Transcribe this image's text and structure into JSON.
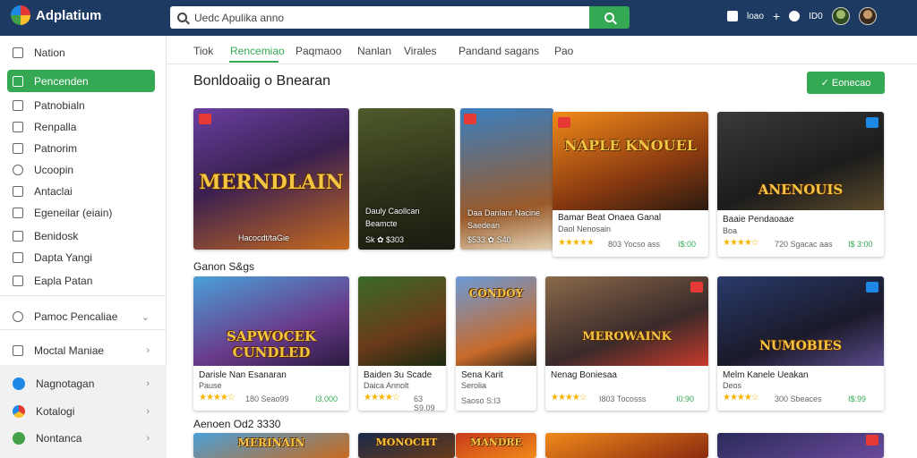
{
  "app": {
    "title": "Adplatium"
  },
  "search": {
    "placeholder": "Uedc Apulika anno",
    "value": "Uedc Apulika anno"
  },
  "topbar": {
    "label_1": "loao",
    "label_2": "ID0"
  },
  "sidebar": {
    "items": [
      {
        "label": "Nation"
      },
      {
        "label": "Pencenden"
      },
      {
        "label": "Patnobialn"
      },
      {
        "label": "Renpalla"
      },
      {
        "label": "Patnorim"
      },
      {
        "label": "Ucoopin"
      },
      {
        "label": "Antaclai"
      },
      {
        "label": "Egeneilar (eiain)"
      },
      {
        "label": "Benidosk"
      },
      {
        "label": "Dapta Yangi"
      },
      {
        "label": "Eapla Patan"
      },
      {
        "label": "Pamoc Pencaliae"
      },
      {
        "label": "Moctal Maniae"
      },
      {
        "label": "Nagnotagan"
      },
      {
        "label": "Kotalogi"
      },
      {
        "label": "Nontanca"
      }
    ]
  },
  "tabs": [
    "Tiok",
    "Rencemiao",
    "Paqmaoo",
    "Nanlan",
    "Virales",
    "Pandand sagans",
    "Pao"
  ],
  "section": {
    "title": "Bonldoaiig  o  Bnearan",
    "button": "✓ Eonecao"
  },
  "row1": [
    {
      "art_title": "MERNDLAIN",
      "art_sub": "Hacocdt/taGie",
      "title": "",
      "sub": "",
      "rating": "",
      "price": ""
    },
    {
      "art_title": "",
      "art_sub": "Dauly Caollcan",
      "art_sub2": "Beamcte",
      "art_sub3": "Sk ✿ $303",
      "title": "",
      "sub": ""
    },
    {
      "art_title": "",
      "art_sub": "Daa Danlanr Nacine",
      "art_sub2": "Saedean",
      "art_sub3": "$533 ✿ S40",
      "title": "",
      "sub": ""
    },
    {
      "art_title": "NAPLE KNOUEL",
      "title": "Bamar Beat Onaea Ganal",
      "sub": "Daol Nenosain",
      "stars": "★★★★★",
      "meta": "803  Yocso ass",
      "price": "I$:00"
    },
    {
      "art_title": "ANENOUIS",
      "title": "Baaie Pendaoaae",
      "sub": "Boa",
      "stars": "★★★★☆",
      "meta": "720  Sgacac aas",
      "price": "I$ 3:00"
    }
  ],
  "section2": {
    "title": "Ganon S&gs"
  },
  "row2": [
    {
      "art_title": "SAPWOCEK CUNDLED",
      "title": "Darisle Nan Esanaran",
      "sub": "Pause",
      "stars": "★★★★☆",
      "meta": "180   Seao99",
      "price": "I3.000"
    },
    {
      "art_title": "",
      "title": "Baiden 3u Scade",
      "sub": "Daica Annolt",
      "stars": "★★★★☆",
      "meta": "63   S9.09",
      "price": ""
    },
    {
      "art_title": "CONDOY",
      "title": "Sena Karit",
      "sub": "Serolia",
      "meta": "Saoso  S:I3",
      "price": ""
    },
    {
      "art_title": "MEROWAINK",
      "title": "Nenag Boniesaa",
      "stars": "★★★★☆",
      "meta": "I803  Tocosss",
      "price": "I0:90"
    },
    {
      "art_title": "NUMOBIES",
      "title": "Melm Kanele Ueakan",
      "sub": "Deos",
      "stars": "★★★★☆",
      "meta": "300  Sbeaces",
      "price": "I$:99"
    }
  ],
  "section3": {
    "title": "Aenoen Od2 3330"
  },
  "row3": [
    {
      "art_title": "MERINAIN"
    },
    {
      "art_title": "MONOCHT"
    },
    {
      "art_title": "MANDRE"
    },
    {
      "art_title": ""
    },
    {
      "art_title": ""
    }
  ],
  "colors": {
    "accent": "#34a853",
    "topbar": "#1d3a63",
    "badge": "#e53935",
    "star": "#f4b400"
  }
}
